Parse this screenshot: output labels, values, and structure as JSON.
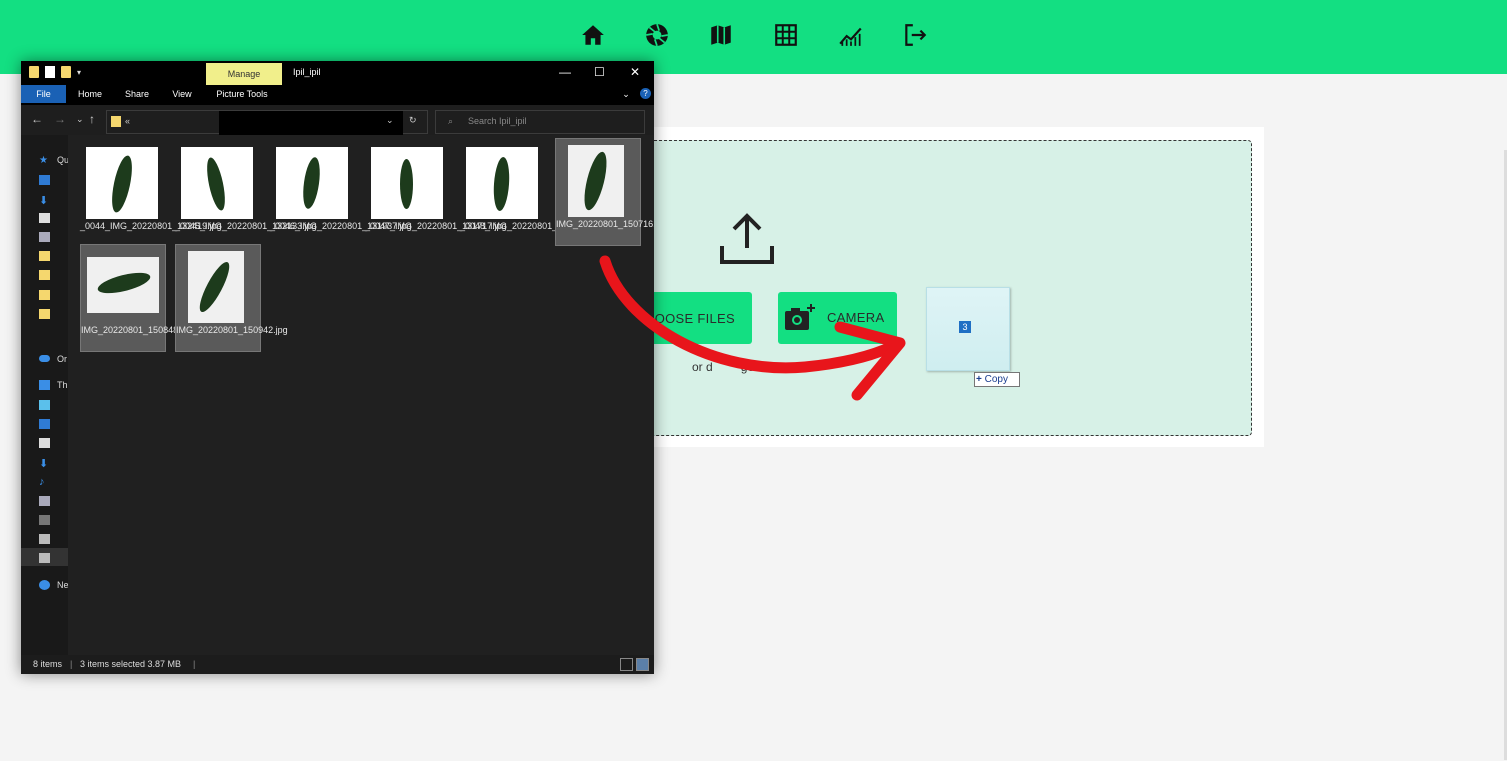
{
  "topbar": {
    "icons": [
      "home-icon",
      "camera-shutter-icon",
      "map-icon",
      "table-icon",
      "chart-icon",
      "logout-icon"
    ]
  },
  "upload": {
    "choose_label": "HOOSE FILES",
    "camera_label": "CAMERA",
    "hint": "or d",
    "hint_end": "ges here",
    "drag_count": "3",
    "copy_label": "Copy"
  },
  "explorer": {
    "manage_tab": "Manage",
    "title": "Ipil_ipil",
    "tabs": [
      "File",
      "Home",
      "Share",
      "View",
      "Picture Tools"
    ],
    "address_prefix": "«",
    "search_placeholder": "Search Ipil_ipil",
    "files": [
      {
        "name": "_0044_IMG_20220801_132419.jpg",
        "selected": false
      },
      {
        "name": "_0045_IMG_20220801_132133.jpg",
        "selected": false
      },
      {
        "name": "_0046_IMG_20220801_131937.jpg",
        "selected": false
      },
      {
        "name": "_0047_IMG_20220801_131717.jpg",
        "selected": false
      },
      {
        "name": "_0048_IMG_20220801_131244.jpg",
        "selected": false
      },
      {
        "name": "IMG_20220801_150716.jpg",
        "selected": true
      },
      {
        "name": "IMG_20220801_150848.jpg",
        "selected": true
      },
      {
        "name": "IMG_20220801_150942.jpg",
        "selected": true
      }
    ],
    "status_items": "8 items",
    "status_selected": "3 items selected  3.87 MB",
    "nav_labels": [
      "Qu",
      "",
      "",
      "",
      "",
      "",
      "",
      "",
      "",
      "Or",
      "Th",
      "",
      "",
      "",
      "",
      "",
      "",
      "",
      "",
      "",
      "Ne"
    ]
  },
  "colors": {
    "accent": "#13df82",
    "dropzone": "#d7f1e7",
    "arrow": "#e8151b"
  }
}
